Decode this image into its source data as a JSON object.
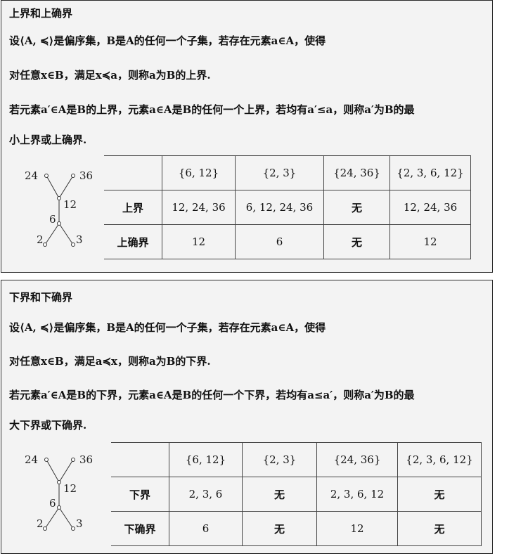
{
  "upper": {
    "title": "上界和上确界",
    "line1": "设⟨A, ≼⟩是偏序集，B是A的任何一个子集，若存在元素a∈A，使得",
    "line2": "对任意x∈B，满足x≼a，则称a为B的上界.",
    "line3": "若元素a′∈A是B的上界，元素a∈A是B的任何一个上界，若均有a′≤a，则称a′为B的最",
    "line4": "小上界或上确界.",
    "hasse": {
      "n24": "24",
      "n36": "36",
      "n12": "12",
      "n6": "6",
      "n2": "2",
      "n3": "3"
    },
    "table": {
      "headers": [
        "{6, 12}",
        "{2, 3}",
        "{24, 36}",
        "{2, 3, 6, 12}"
      ],
      "rows": [
        {
          "label": "上界",
          "cells": [
            "12, 24, 36",
            "6, 12, 24, 36",
            "无",
            "12, 24, 36"
          ]
        },
        {
          "label": "上确界",
          "cells": [
            "12",
            "6",
            "无",
            "12"
          ]
        }
      ]
    }
  },
  "lower": {
    "title": "下界和下确界",
    "line1": "设⟨A, ≼⟩是偏序集，B是A的任何一个子集，若存在元素a∈A，使得",
    "line2": "对任意x∈B，满足a≼x，则称a为B的下界.",
    "line3": "若元素a′∈A是B的下界，元素a∈A是B的任何一个下界，若均有a≤a′，则称a′为B的最",
    "line4": "大下界或下确界.",
    "hasse": {
      "n24": "24",
      "n36": "36",
      "n12": "12",
      "n6": "6",
      "n2": "2",
      "n3": "3"
    },
    "table": {
      "headers": [
        "{6, 12}",
        "{2, 3}",
        "{24, 36}",
        "{2, 3, 6, 12}"
      ],
      "rows": [
        {
          "label": "下界",
          "cells": [
            "2, 3, 6",
            "无",
            "2, 3, 6, 12",
            "无"
          ]
        },
        {
          "label": "下确界",
          "cells": [
            "6",
            "无",
            "12",
            "无"
          ]
        }
      ]
    }
  }
}
